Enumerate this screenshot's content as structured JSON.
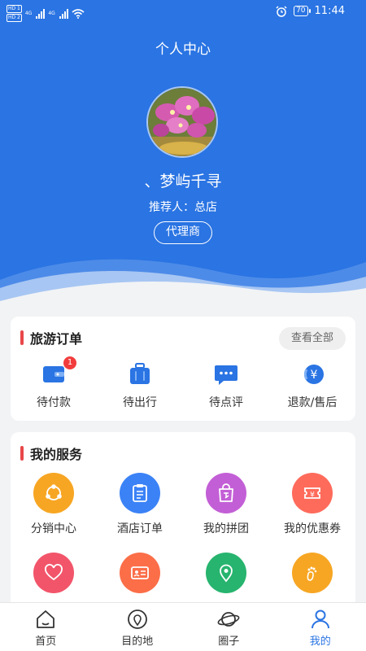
{
  "status_bar": {
    "time": "11:44",
    "battery": "70",
    "sim1": "HD 1",
    "sim2": "HD 2",
    "net": "4G"
  },
  "header": {
    "title": "个人中心",
    "username": "、梦屿千寻",
    "referrer": "推荐人：总店",
    "role": "代理商"
  },
  "orders": {
    "title": "旅游订单",
    "view_all": "查看全部",
    "items": [
      {
        "label": "待付款",
        "icon": "wallet-icon",
        "badge": "1"
      },
      {
        "label": "待出行",
        "icon": "luggage-icon"
      },
      {
        "label": "待点评",
        "icon": "comment-icon"
      },
      {
        "label": "退款/售后",
        "icon": "refund-icon"
      }
    ]
  },
  "services": {
    "title": "我的服务",
    "items": [
      {
        "label": "分销中心",
        "icon": "share-icon",
        "color": "#f7a623"
      },
      {
        "label": "酒店订单",
        "icon": "clipboard-icon",
        "color": "#3b82f6"
      },
      {
        "label": "我的拼团",
        "icon": "shopping-bag-icon",
        "color": "#c35fd6"
      },
      {
        "label": "我的优惠券",
        "icon": "coupon-icon",
        "color": "#ff6b5b"
      },
      {
        "label": "",
        "icon": "heart-icon",
        "color": "#f2556a"
      },
      {
        "label": "",
        "icon": "id-card-icon",
        "color": "#fb6e48"
      },
      {
        "label": "",
        "icon": "location-pin-icon",
        "color": "#27b46e"
      },
      {
        "label": "",
        "icon": "footprint-icon",
        "color": "#f7a623"
      }
    ]
  },
  "tabbar": {
    "items": [
      {
        "label": "首页",
        "icon": "home-icon"
      },
      {
        "label": "目的地",
        "icon": "destination-icon"
      },
      {
        "label": "圈子",
        "icon": "planet-icon"
      },
      {
        "label": "我的",
        "icon": "person-icon",
        "active": true
      }
    ]
  },
  "colors": {
    "primary": "#2a74e3",
    "accent_red": "#e8474a",
    "badge_red": "#f23c3c"
  }
}
